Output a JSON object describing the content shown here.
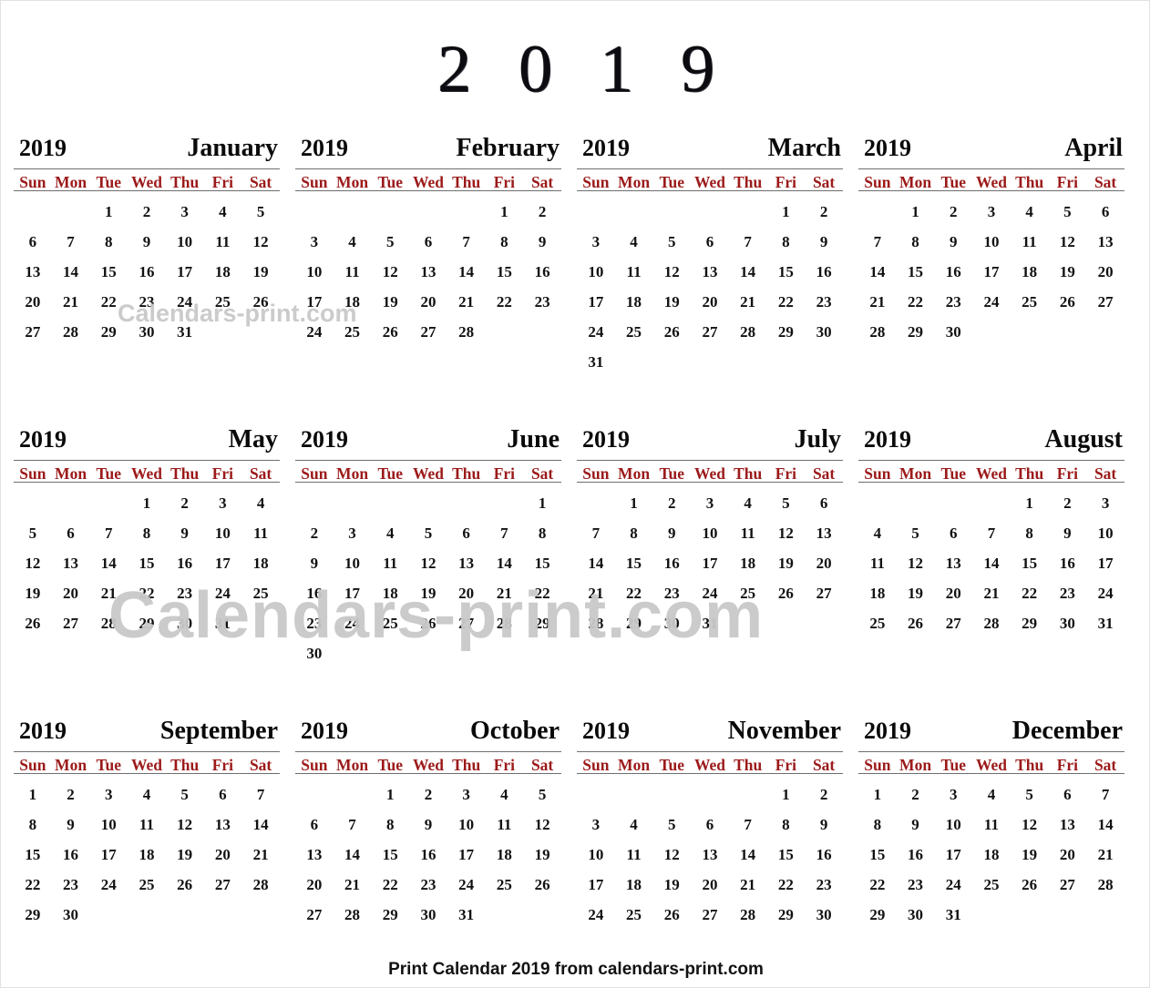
{
  "page": {
    "title": "2019",
    "footer": "Print Calendar 2019 from calendars-print.com",
    "watermark_small": "Calendars-print.com",
    "watermark_big": "Calendars-print.com",
    "year": "2019",
    "accent_color": "#9c1a1a",
    "text_color": "#111111",
    "rule_color": "#6e6e6e",
    "watermark_color": "#c9c9c9",
    "background": "#ffffff"
  },
  "weekdays": [
    "Sun",
    "Mon",
    "Tue",
    "Wed",
    "Thu",
    "Fri",
    "Sat"
  ],
  "months": [
    {
      "year": "2019",
      "name": "January",
      "first_weekday": 2,
      "days": 31,
      "weeks": [
        [
          "",
          "",
          "1",
          "2",
          "3",
          "4",
          "5"
        ],
        [
          "6",
          "7",
          "8",
          "9",
          "10",
          "11",
          "12"
        ],
        [
          "13",
          "14",
          "15",
          "16",
          "17",
          "18",
          "19"
        ],
        [
          "20",
          "21",
          "22",
          "23",
          "24",
          "25",
          "26"
        ],
        [
          "27",
          "28",
          "29",
          "30",
          "31",
          "",
          ""
        ]
      ]
    },
    {
      "year": "2019",
      "name": "February",
      "first_weekday": 5,
      "days": 28,
      "weeks": [
        [
          "",
          "",
          "",
          "",
          "",
          "1",
          "2"
        ],
        [
          "3",
          "4",
          "5",
          "6",
          "7",
          "8",
          "9"
        ],
        [
          "10",
          "11",
          "12",
          "13",
          "14",
          "15",
          "16"
        ],
        [
          "17",
          "18",
          "19",
          "20",
          "21",
          "22",
          "23"
        ],
        [
          "24",
          "25",
          "26",
          "27",
          "28",
          "",
          ""
        ]
      ]
    },
    {
      "year": "2019",
      "name": "March",
      "first_weekday": 5,
      "days": 31,
      "weeks": [
        [
          "",
          "",
          "",
          "",
          "",
          "1",
          "2"
        ],
        [
          "3",
          "4",
          "5",
          "6",
          "7",
          "8",
          "9"
        ],
        [
          "10",
          "11",
          "12",
          "13",
          "14",
          "15",
          "16"
        ],
        [
          "17",
          "18",
          "19",
          "20",
          "21",
          "22",
          "23"
        ],
        [
          "24",
          "25",
          "26",
          "27",
          "28",
          "29",
          "30"
        ],
        [
          "31",
          "",
          "",
          "",
          "",
          "",
          ""
        ]
      ]
    },
    {
      "year": "2019",
      "name": "April",
      "first_weekday": 1,
      "days": 30,
      "weeks": [
        [
          "",
          "1",
          "2",
          "3",
          "4",
          "5",
          "6"
        ],
        [
          "7",
          "8",
          "9",
          "10",
          "11",
          "12",
          "13"
        ],
        [
          "14",
          "15",
          "16",
          "17",
          "18",
          "19",
          "20"
        ],
        [
          "21",
          "22",
          "23",
          "24",
          "25",
          "26",
          "27"
        ],
        [
          "28",
          "29",
          "30",
          "",
          "",
          "",
          ""
        ]
      ]
    },
    {
      "year": "2019",
      "name": "May",
      "first_weekday": 3,
      "days": 31,
      "weeks": [
        [
          "",
          "",
          "",
          "1",
          "2",
          "3",
          "4"
        ],
        [
          "5",
          "6",
          "7",
          "8",
          "9",
          "10",
          "11"
        ],
        [
          "12",
          "13",
          "14",
          "15",
          "16",
          "17",
          "18"
        ],
        [
          "19",
          "20",
          "21",
          "22",
          "23",
          "24",
          "25"
        ],
        [
          "26",
          "27",
          "28",
          "29",
          "30",
          "31",
          ""
        ]
      ]
    },
    {
      "year": "2019",
      "name": "June",
      "first_weekday": 6,
      "days": 30,
      "weeks": [
        [
          "",
          "",
          "",
          "",
          "",
          "",
          "1"
        ],
        [
          "2",
          "3",
          "4",
          "5",
          "6",
          "7",
          "8"
        ],
        [
          "9",
          "10",
          "11",
          "12",
          "13",
          "14",
          "15"
        ],
        [
          "16",
          "17",
          "18",
          "19",
          "20",
          "21",
          "22"
        ],
        [
          "23",
          "24",
          "25",
          "26",
          "27",
          "28",
          "29"
        ],
        [
          "30",
          "",
          "",
          "",
          "",
          "",
          ""
        ]
      ]
    },
    {
      "year": "2019",
      "name": "July",
      "first_weekday": 1,
      "days": 31,
      "weeks": [
        [
          "",
          "1",
          "2",
          "3",
          "4",
          "5",
          "6"
        ],
        [
          "7",
          "8",
          "9",
          "10",
          "11",
          "12",
          "13"
        ],
        [
          "14",
          "15",
          "16",
          "17",
          "18",
          "19",
          "20"
        ],
        [
          "21",
          "22",
          "23",
          "24",
          "25",
          "26",
          "27"
        ],
        [
          "28",
          "29",
          "30",
          "31",
          "",
          "",
          ""
        ]
      ]
    },
    {
      "year": "2019",
      "name": "August",
      "first_weekday": 4,
      "days": 31,
      "weeks": [
        [
          "",
          "",
          "",
          "",
          "1",
          "2",
          "3"
        ],
        [
          "4",
          "5",
          "6",
          "7",
          "8",
          "9",
          "10"
        ],
        [
          "11",
          "12",
          "13",
          "14",
          "15",
          "16",
          "17"
        ],
        [
          "18",
          "19",
          "20",
          "21",
          "22",
          "23",
          "24"
        ],
        [
          "25",
          "26",
          "27",
          "28",
          "29",
          "30",
          "31"
        ]
      ]
    },
    {
      "year": "2019",
      "name": "September",
      "first_weekday": 0,
      "days": 30,
      "weeks": [
        [
          "1",
          "2",
          "3",
          "4",
          "5",
          "6",
          "7"
        ],
        [
          "8",
          "9",
          "10",
          "11",
          "12",
          "13",
          "14"
        ],
        [
          "15",
          "16",
          "17",
          "18",
          "19",
          "20",
          "21"
        ],
        [
          "22",
          "23",
          "24",
          "25",
          "26",
          "27",
          "28"
        ],
        [
          "29",
          "30",
          "",
          "",
          "",
          "",
          ""
        ]
      ]
    },
    {
      "year": "2019",
      "name": "October",
      "first_weekday": 2,
      "days": 31,
      "weeks": [
        [
          "",
          "",
          "1",
          "2",
          "3",
          "4",
          "5"
        ],
        [
          "6",
          "7",
          "8",
          "9",
          "10",
          "11",
          "12"
        ],
        [
          "13",
          "14",
          "15",
          "16",
          "17",
          "18",
          "19"
        ],
        [
          "20",
          "21",
          "22",
          "23",
          "24",
          "25",
          "26"
        ],
        [
          "27",
          "28",
          "29",
          "30",
          "31",
          "",
          ""
        ]
      ]
    },
    {
      "year": "2019",
      "name": "November",
      "first_weekday": 5,
      "days": 30,
      "weeks": [
        [
          "",
          "",
          "",
          "",
          "",
          "1",
          "2"
        ],
        [
          "3",
          "4",
          "5",
          "6",
          "7",
          "8",
          "9"
        ],
        [
          "10",
          "11",
          "12",
          "13",
          "14",
          "15",
          "16"
        ],
        [
          "17",
          "18",
          "19",
          "20",
          "21",
          "22",
          "23"
        ],
        [
          "24",
          "25",
          "26",
          "27",
          "28",
          "29",
          "30"
        ]
      ]
    },
    {
      "year": "2019",
      "name": "December",
      "first_weekday": 0,
      "days": 31,
      "weeks": [
        [
          "1",
          "2",
          "3",
          "4",
          "5",
          "6",
          "7"
        ],
        [
          "8",
          "9",
          "10",
          "11",
          "12",
          "13",
          "14"
        ],
        [
          "15",
          "16",
          "17",
          "18",
          "19",
          "20",
          "21"
        ],
        [
          "22",
          "23",
          "24",
          "25",
          "26",
          "27",
          "28"
        ],
        [
          "29",
          "30",
          "31",
          "",
          "",
          "",
          ""
        ]
      ]
    }
  ]
}
